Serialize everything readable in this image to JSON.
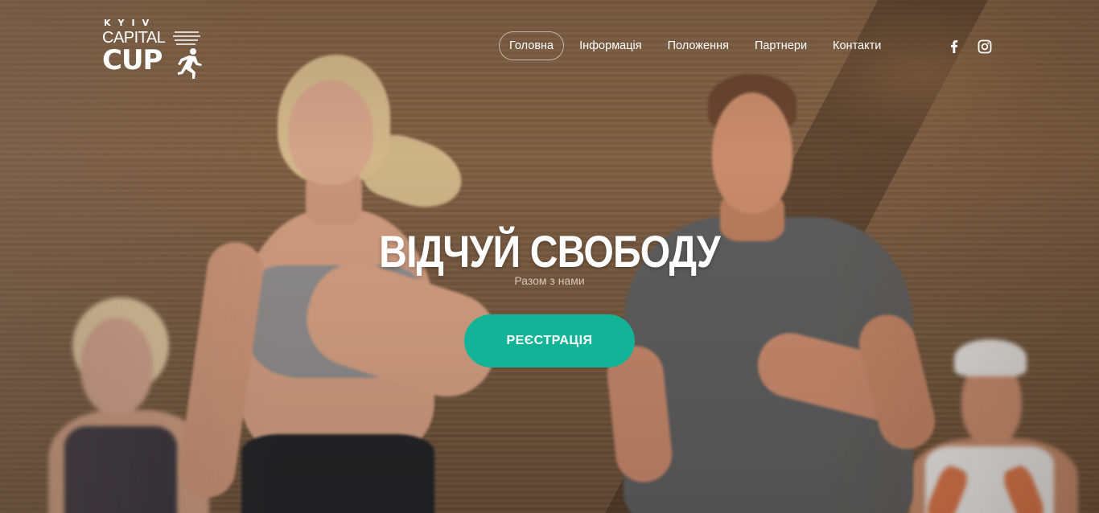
{
  "logo": {
    "line1": "KYIV",
    "line2": "CAPITAL",
    "line3": "CUP"
  },
  "nav": {
    "items": [
      {
        "label": "Головна",
        "active": true
      },
      {
        "label": "Інформація",
        "active": false
      },
      {
        "label": "Положення",
        "active": false
      },
      {
        "label": "Партнери",
        "active": false
      },
      {
        "label": "Контакти",
        "active": false
      }
    ]
  },
  "social": {
    "icons": [
      "facebook-icon",
      "instagram-icon"
    ]
  },
  "hero": {
    "title": "ВІДЧУЙ СВОБОДУ",
    "subtitle": "Разом з нами",
    "cta_label": "РЕЄСТРАЦІЯ"
  },
  "colors": {
    "accent": "#12b397",
    "text": "#ffffff"
  }
}
